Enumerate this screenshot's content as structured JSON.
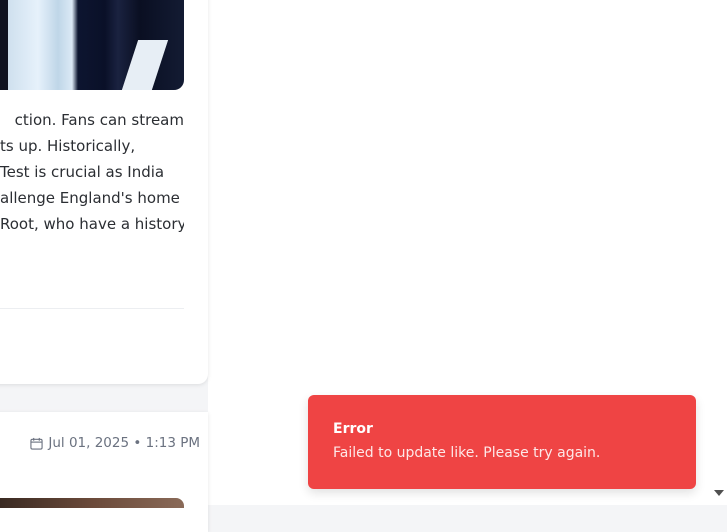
{
  "post1": {
    "text_lines": [
      "ction. Fans can stream",
      "ts up. Historically,",
      "Test is crucial as India",
      "allenge England's home",
      "Root, who have a history"
    ]
  },
  "post2": {
    "date": "Jul 01, 2025 • 1:13 PM",
    "date_icon": "calendar-icon"
  },
  "toast": {
    "title": "Error",
    "message": "Failed to update like. Please try again.",
    "color": "#ef4444"
  }
}
